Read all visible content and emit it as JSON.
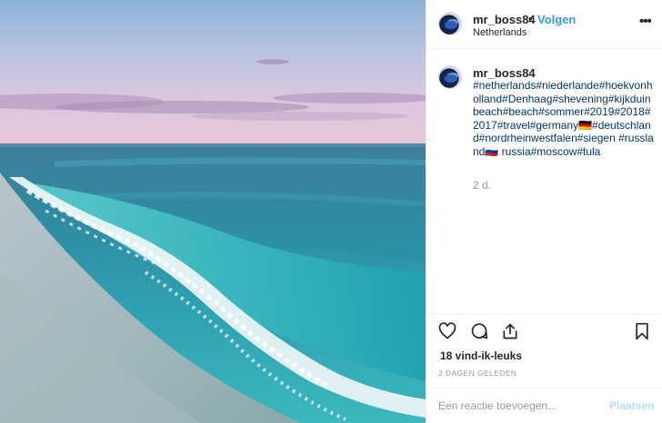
{
  "post": {
    "username": "mr_boss84",
    "separator": "•",
    "follow_label": "Volgen",
    "location": "Netherlands",
    "more_icon": "ellipsis-icon",
    "more_label": "•••"
  },
  "caption": {
    "username": "mr_boss84",
    "hashtags_text": "#netherlands#niederlande#hoekvonholland#Denhaag#shevening#kijkduinbeach#beach#sommer#2019#2018#2017#travel#germany🇩🇪#deutschland#nordrheinwestfalen#siegen #russland🇷🇺 russia#moscow#tula",
    "age": "2 d."
  },
  "actions": {
    "like_icon": "heart-icon",
    "comment_icon": "comment-icon",
    "share_icon": "share-icon",
    "save_icon": "bookmark-icon"
  },
  "likes_text": "18 vind-ik-leuks",
  "timestamp": "2 DAGEN GELEDEN",
  "comment_box": {
    "placeholder": "Een reactie toevoegen...",
    "post_label": "Plaatsen"
  },
  "colors": {
    "link_blue": "#3897f0",
    "hashtag_blue": "#003569",
    "disabled_blue": "#b2dffc",
    "muted_gray": "#999999",
    "border": "#efefef"
  }
}
